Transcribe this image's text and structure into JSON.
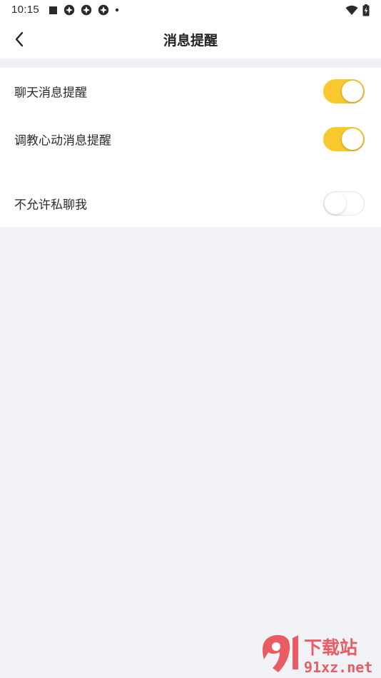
{
  "status_bar": {
    "time": "10:15",
    "left_icons": [
      "stop-square-icon",
      "app-icon",
      "app-icon",
      "app-icon",
      "dot-icon"
    ],
    "right_icons": [
      "wifi-icon",
      "battery-charging-icon"
    ]
  },
  "header": {
    "title": "消息提醒",
    "back_icon": "chevron-left-icon"
  },
  "settings": [
    {
      "label": "聊天消息提醒",
      "enabled": true
    },
    {
      "label": "调教心动消息提醒",
      "enabled": true
    },
    {
      "label": "不允许私聊我",
      "enabled": false
    }
  ],
  "colors": {
    "accent": "#f9c82e",
    "page_background": "#f1f2f6"
  },
  "watermark": {
    "logo_text": "9l下载站",
    "domain": "91xz.net"
  }
}
